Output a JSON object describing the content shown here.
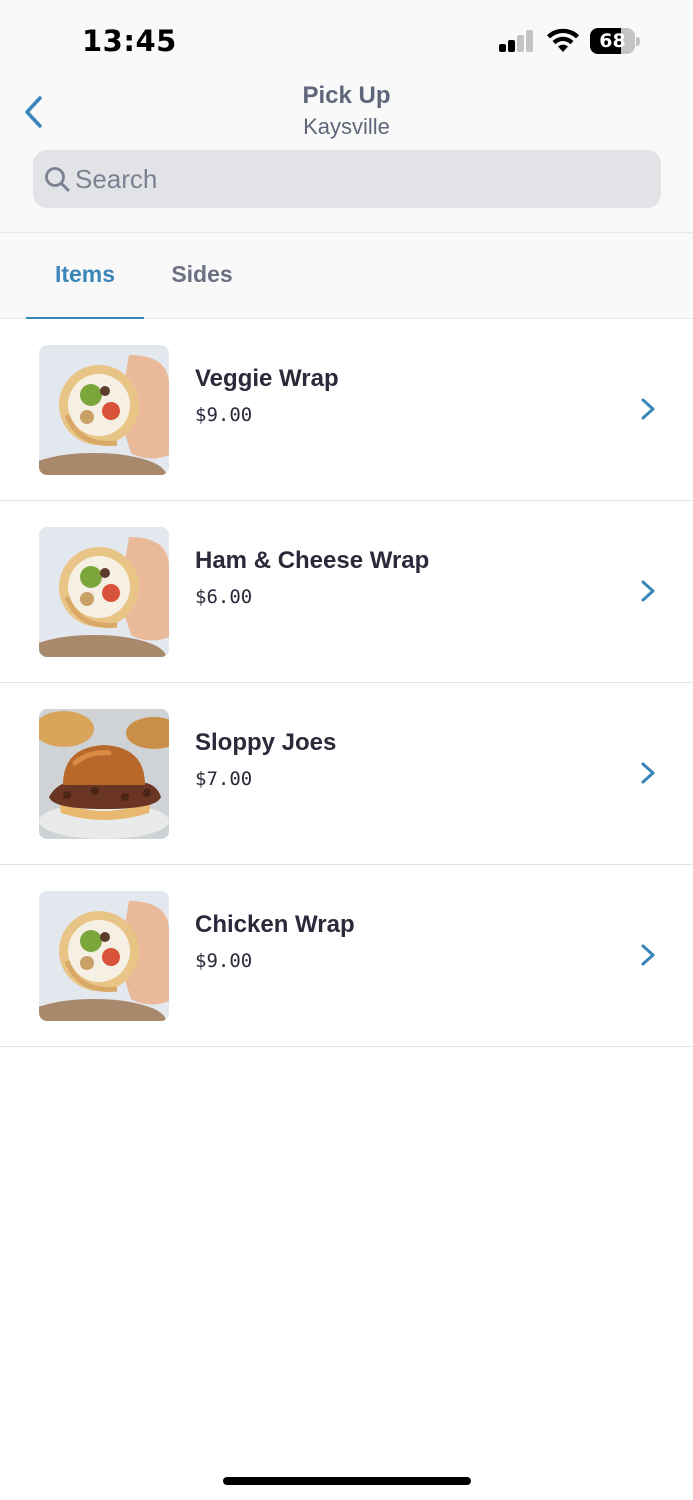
{
  "status_bar": {
    "time": "13:45",
    "battery": "68",
    "battery_level": 0.68
  },
  "nav": {
    "title": "Pick Up",
    "subtitle": "Kaysville",
    "back_icon": "chevron-left-icon"
  },
  "search": {
    "placeholder": "Search",
    "value": ""
  },
  "tabs": [
    {
      "label": "Items",
      "active": true
    },
    {
      "label": "Sides",
      "active": false
    }
  ],
  "items": [
    {
      "name": "Veggie Wrap",
      "price": "$9.00",
      "image": "wrap-photo"
    },
    {
      "name": "Ham & Cheese Wrap",
      "price": "$6.00",
      "image": "wrap-photo"
    },
    {
      "name": "Sloppy Joes",
      "price": "$7.00",
      "image": "sloppy-joe-photo"
    },
    {
      "name": "Chicken Wrap",
      "price": "$9.00",
      "image": "wrap-photo"
    }
  ],
  "colors": {
    "accent": "#3a86b8",
    "muted_text": "#5f6679",
    "search_bg": "#e2e3e7"
  }
}
